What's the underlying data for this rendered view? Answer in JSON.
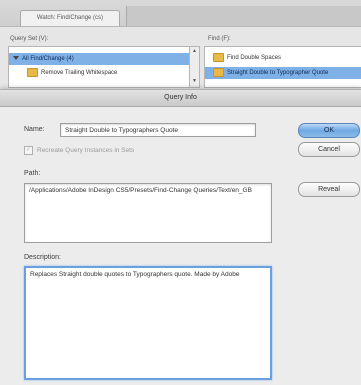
{
  "background_window": {
    "tab_label": "Watch: Find/Change (cs)",
    "left_pane_label": "Query Set (V):",
    "right_pane_label": "Find (F):",
    "left_list": [
      {
        "label": "All Find/Change (4)",
        "selected": true
      },
      {
        "label": "Remove Trailing Whitespace",
        "selected": false
      }
    ],
    "right_list": [
      {
        "label": "Find Double Spaces",
        "selected": false
      },
      {
        "label": "Straight Double to Typographer Quote",
        "selected": true
      }
    ]
  },
  "dialog": {
    "title": "Query Info",
    "name_label": "Name:",
    "name_value": "Straight Double to Typographers Quote",
    "checkbox_label": "Recreate Query Instances in Sets",
    "path_label": "Path:",
    "path_value": "/Applications/Adobe InDesign CS5/Presets/Find-Change Queries/Text/en_GB",
    "description_label": "Description:",
    "description_value": "Replaces Straight double quotes to Typographers quote. Made by Adobe",
    "buttons": {
      "ok": "OK",
      "cancel": "Cancel",
      "reveal": "Reveal"
    }
  }
}
